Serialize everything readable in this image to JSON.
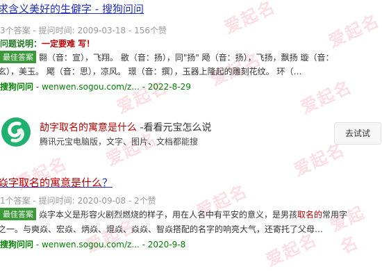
{
  "watermark": "爱起名",
  "result1": {
    "title_prefix": "求含义美好的生僻字",
    "title_suffix": " - 搜狗问问",
    "meta": "3个答案 - 提问时间: 2009-03-18 - 156个赞",
    "question_label": "问题说明：",
    "question_text": "一定要难 写！",
    "badge": "最佳答案",
    "line1": "翾（音：宣），飞翔。 敭（音：扬），同\"扬\" 飏（音：扬），飞扬，飘扬 璇（音：",
    "line2": "玄），美玉。 飔（音：思），凉风。 璟（音：撰），玉器上隆起的雕刻花纹。 环（…",
    "source_site": "搜狗问问",
    "source_rest": " - wenwen.sogou.com/z... - 2022-8-29"
  },
  "ad": {
    "title_highlight": "劼字取名的寓意是什么",
    "title_rest": " -看看元宝怎么说",
    "subtitle": "腾讯元宝电脑版，文字、图片、文档都能搜",
    "button": "去试试"
  },
  "result2": {
    "title_highlight": "焱字取名的寓意是什么",
    "title_rest": "？",
    "meta": "1个答案 - 提问时间: 2020-09-08 - 2个赞",
    "badge": "最佳答案",
    "line1_pre": "焱字本义是形容火剧烈燃烧的样子，用在人名中有平安的意义，是男孩",
    "line1_red": "取名的",
    "line1_post": "常用字",
    "line2": "之一。与奭焱、宏焱、炳焱、焜焱、焱焱、智焱搭配的名字的响亮大气，还寄托了父母…",
    "source_site": "搜狗问问",
    "source_rest": " - wenwen.sogou.com/z... - 2020-9-8"
  }
}
